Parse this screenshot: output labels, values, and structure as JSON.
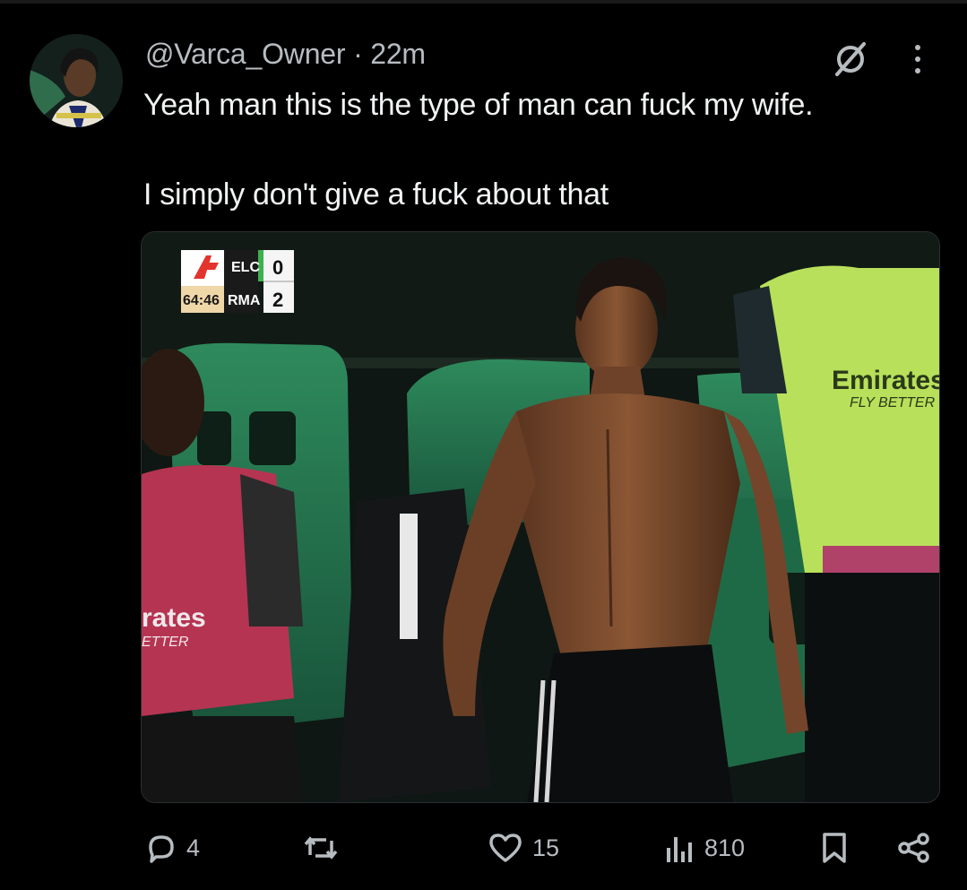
{
  "post": {
    "handle": "@Varca_Owner",
    "separator": "·",
    "time": "22m",
    "text_line1": "Yeah man this is the type of man can fuck my wife.",
    "text_line2": "I simply don't give a fuck about that"
  },
  "media": {
    "scoreboard": {
      "clock": "64:46",
      "home_team": "ELC",
      "away_team": "RMA",
      "home_score": "0",
      "away_score": "2"
    },
    "sponsor_text": "Emirates",
    "sponsor_tagline": "FLY BETTER",
    "sponsor_partial": "rates",
    "sponsor_partial_tagline": "ETTER"
  },
  "actions": {
    "replies": "4",
    "reposts": "",
    "likes": "15",
    "views": "810"
  },
  "colors": {
    "background": "#000000",
    "text": "#e7e9ea",
    "muted": "#b7bcc1"
  }
}
